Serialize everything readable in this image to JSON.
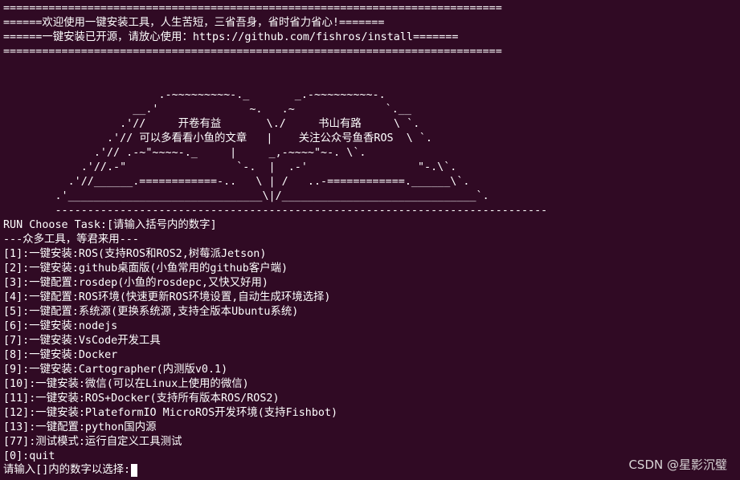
{
  "terminal": {
    "background": "#300a24",
    "foreground": "#ffffff",
    "banner": [
      "=============================================================================",
      "======欢迎使用一键安装工具，人生苦短，三省吾身，省时省力省心!=======",
      "======一键安装已开源，请放心使用：https://github.com/fishros/install=======",
      "============================================================================="
    ],
    "art": [
      "                        .-~~~~~~~~~-._       _.-~~~~~~~~~-.",
      "                    __.'              ~.   .~              `.__",
      "                  .'//     开卷有益       \\./     书山有路     \\ `.",
      "                .'// 可以多看看小鱼的文章   |    关注公众号鱼香ROS  \\ `.",
      "              .'// .-~\"~~~~-._     |     _,-~~~~\"~-. \\`.",
      "            .'//.-\"                 `-.  |  .-'                 \"-.\\`.",
      "          .'//______.============-..   \\ | /   ..-============.______\\`.",
      "        .'______________________________\\|/______________________________`.",
      "        ----------------------------------------------------------------------------"
    ],
    "title_line": "RUN Choose Task:[请输入括号内的数字]",
    "subtitle_line": "---众多工具，等君来用---",
    "menu": [
      "[1]:一键安装:ROS(支持ROS和ROS2,树莓派Jetson)",
      "[2]:一键安装:github桌面版(小鱼常用的github客户端)",
      "[3]:一键配置:rosdep(小鱼的rosdepc,又快又好用)",
      "[4]:一键配置:ROS环境(快速更新ROS环境设置,自动生成环境选择)",
      "[5]:一键配置:系统源(更换系统源,支持全版本Ubuntu系统)",
      "[6]:一键安装:nodejs",
      "[7]:一键安装:VsCode开发工具",
      "[8]:一键安装:Docker",
      "[9]:一键安装:Cartographer(内测版v0.1)",
      "[10]:一键安装:微信(可以在Linux上使用的微信)",
      "[11]:一键安装:ROS+Docker(支持所有版本ROS/ROS2)",
      "[12]:一键安装:PlateformIO MicroROS开发环境(支持Fishbot)",
      "[13]:一键配置:python国内源",
      "[77]:测试模式:运行自定义工具测试",
      "[0]:quit"
    ],
    "prompt": "请输入[]内的数字以选择:"
  },
  "watermark": "CSDN @星影沉璧"
}
